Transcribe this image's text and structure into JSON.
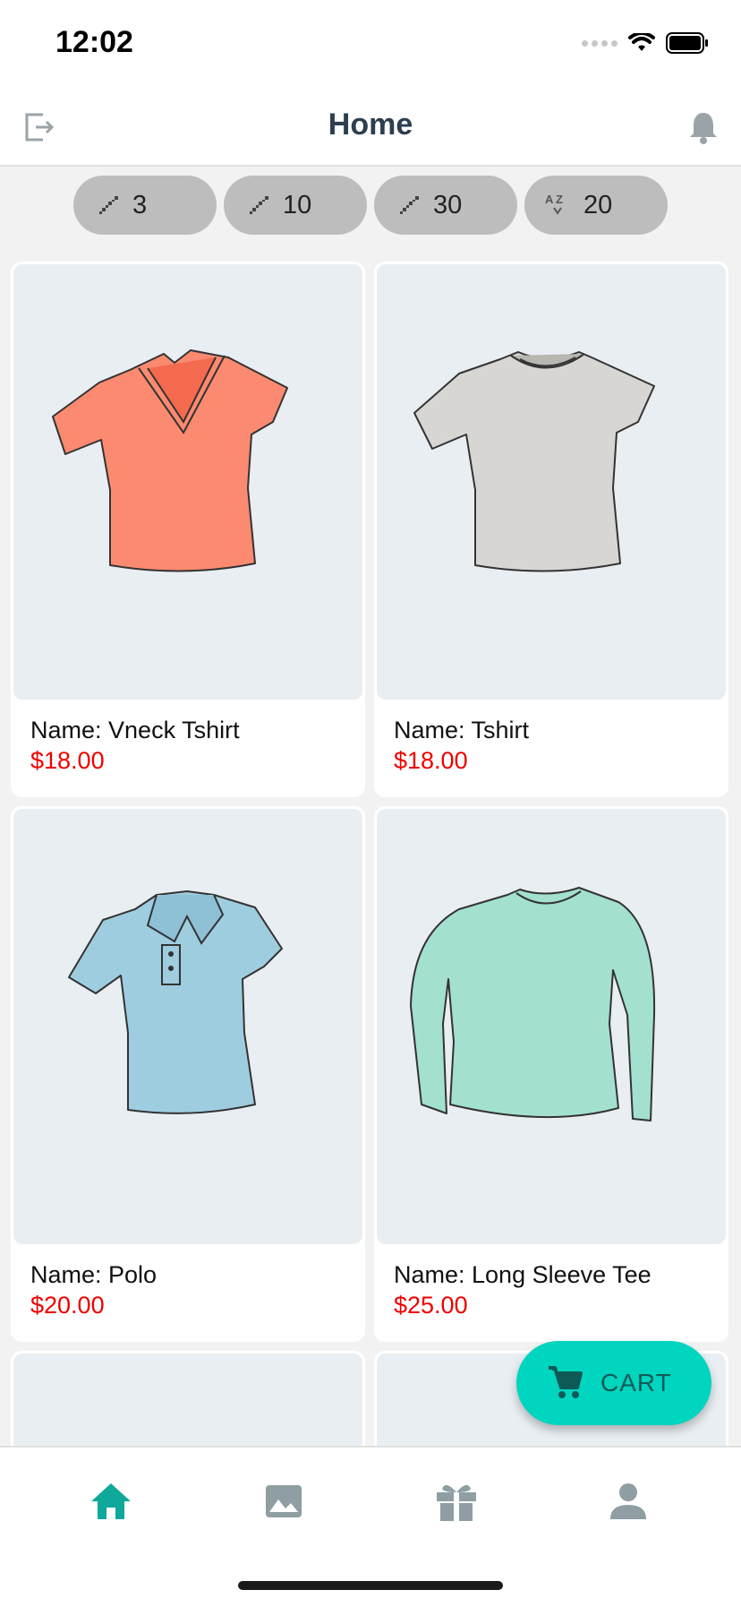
{
  "status_bar": {
    "time": "12:02"
  },
  "header": {
    "title": "Home",
    "logout_icon": "logout-icon",
    "bell_icon": "bell-icon"
  },
  "filters": [
    {
      "icon": "stairs-icon",
      "value": "3"
    },
    {
      "icon": "stairs-icon",
      "value": "10"
    },
    {
      "icon": "stairs-icon",
      "value": "30"
    },
    {
      "icon": "sort-az-icon",
      "value": "20"
    }
  ],
  "products": [
    {
      "name": "Name: Vneck Tshirt",
      "price": "$18.00",
      "color": "#fb8a70"
    },
    {
      "name": "Name: Tshirt",
      "price": "$18.00",
      "color": "#d8d6d2"
    },
    {
      "name": "Name: Polo",
      "price": "$20.00",
      "color": "#9fcde0"
    },
    {
      "name": "Name: Long Sleeve Tee",
      "price": "$25.00",
      "color": "#a3e0cf"
    }
  ],
  "fab": {
    "label": "CART",
    "icon": "cart-icon"
  },
  "tabbar": {
    "items": [
      {
        "icon": "home-icon",
        "active": true
      },
      {
        "icon": "image-icon",
        "active": false
      },
      {
        "icon": "gift-icon",
        "active": false
      },
      {
        "icon": "person-icon",
        "active": false
      }
    ]
  },
  "colors": {
    "accent": "#00d5bf",
    "active_tab": "#0fa99a",
    "inactive_tab": "#8e9ea3",
    "price": "#ee0000",
    "title": "#2c3e50"
  }
}
